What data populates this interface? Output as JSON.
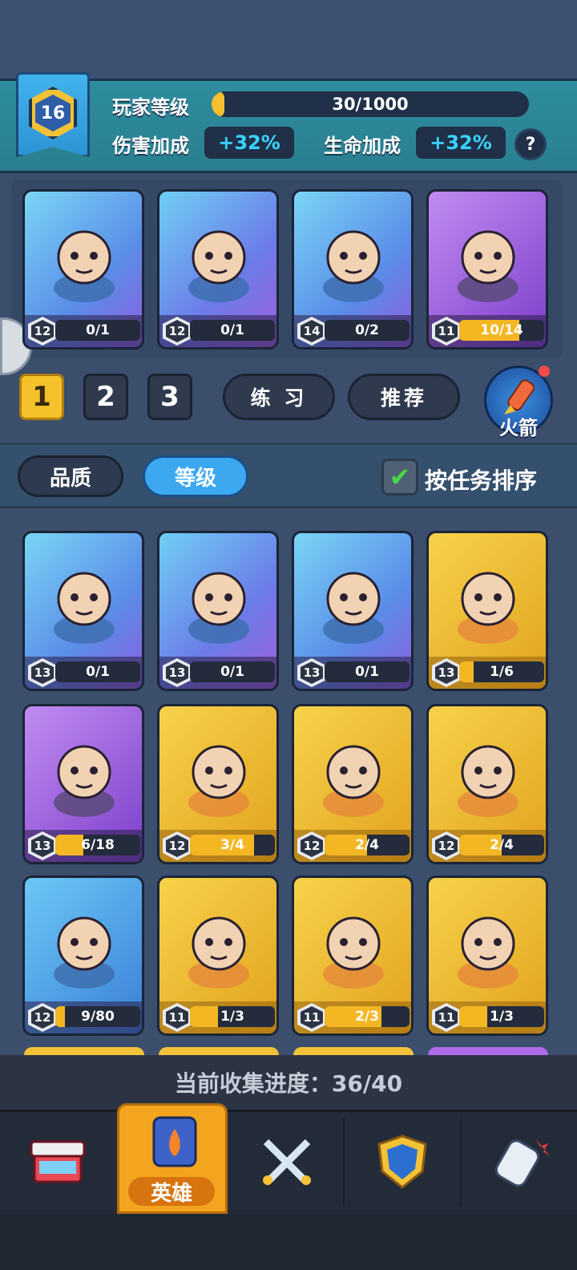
{
  "player": {
    "level": "16",
    "level_label": "玩家等级",
    "xp_text": "30/1000",
    "xp_fraction": 0.03,
    "damage_label": "伤害加成",
    "damage_value": "+32%",
    "hp_label": "生命加成",
    "hp_value": "+32%",
    "help_symbol": "?"
  },
  "team": [
    {
      "name": "jade-ghost-hero",
      "level": "12",
      "progress": "0/1",
      "fill": 0.0,
      "rarity": "blue"
    },
    {
      "name": "monkey-king-hero",
      "level": "12",
      "progress": "0/1",
      "fill": 0.0,
      "rarity": "bluep"
    },
    {
      "name": "chef-fish-hero",
      "level": "14",
      "progress": "0/2",
      "fill": 0.0,
      "rarity": "blue"
    },
    {
      "name": "zombie-pirate-hero",
      "level": "11",
      "progress": "10/14",
      "fill": 0.71,
      "rarity": "purple"
    }
  ],
  "tabs": {
    "team_tabs": [
      "1",
      "2",
      "3"
    ],
    "active_tab": 0,
    "practice": "练 习",
    "recommend": "推荐",
    "rocket_label": "火箭"
  },
  "sort": {
    "quality": "品质",
    "level": "等级",
    "task_sort": "按任务排序",
    "checked": "✔"
  },
  "heroes": [
    {
      "name": "anubis-hero",
      "level": "13",
      "progress": "0/1",
      "fill": 0.0,
      "rarity": "blue"
    },
    {
      "name": "phoenix-hero",
      "level": "13",
      "progress": "0/1",
      "fill": 0.0,
      "rarity": "bluep"
    },
    {
      "name": "pirate-captain-hero",
      "level": "13",
      "progress": "0/1",
      "fill": 0.0,
      "rarity": "blue"
    },
    {
      "name": "masked-shaman-hero",
      "level": "13",
      "progress": "1/6",
      "fill": 0.17,
      "rarity": "gold"
    },
    {
      "name": "straw-hat-ninja-hero",
      "level": "13",
      "progress": "6/18",
      "fill": 0.33,
      "rarity": "purple"
    },
    {
      "name": "cloud-spirit-hero",
      "level": "12",
      "progress": "3/4",
      "fill": 0.75,
      "rarity": "gold"
    },
    {
      "name": "cat-sage-hero",
      "level": "12",
      "progress": "2/4",
      "fill": 0.5,
      "rarity": "gold"
    },
    {
      "name": "spider-hero",
      "level": "12",
      "progress": "2/4",
      "fill": 0.5,
      "rarity": "gold"
    },
    {
      "name": "blonde-archer-hero",
      "level": "12",
      "progress": "9/80",
      "fill": 0.11,
      "rarity": "sky"
    },
    {
      "name": "knight-hero",
      "level": "11",
      "progress": "1/3",
      "fill": 0.33,
      "rarity": "gold"
    },
    {
      "name": "dark-maiden-hero",
      "level": "11",
      "progress": "2/3",
      "fill": 0.67,
      "rarity": "gold"
    },
    {
      "name": "fox-mask-girl-hero",
      "level": "11",
      "progress": "1/3",
      "fill": 0.33,
      "rarity": "gold"
    }
  ],
  "collection": "当前收集进度：36/40",
  "nav": {
    "items": [
      "shop-icon",
      "heroes-icon",
      "battle-swords-icon",
      "guild-shield-icon",
      "gauntlet-icon"
    ],
    "active_label": "英雄"
  },
  "colors": {
    "gold": "#f5c22b",
    "accent_blue": "#3ba8f0",
    "bonus_text": "#3ad4ff"
  }
}
